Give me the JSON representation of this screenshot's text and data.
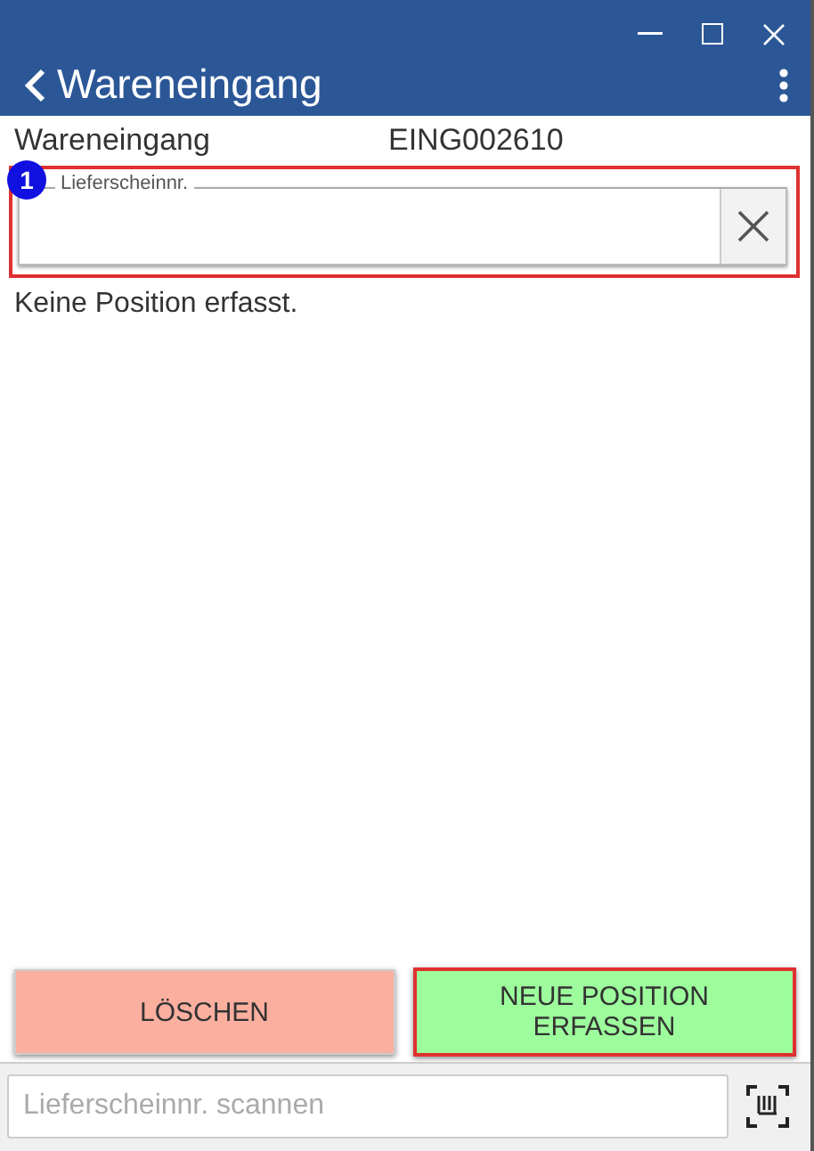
{
  "window": {
    "title": "Wareneingang"
  },
  "info": {
    "label": "Wareneingang",
    "value": "EING002610"
  },
  "field": {
    "badge": "1",
    "label": "Lieferscheinnr.",
    "highlighted": true
  },
  "message": "Keine Position erfasst.",
  "buttons": [
    {
      "label": "LÖSCHEN",
      "kind": "delete",
      "highlighted": false
    },
    {
      "label": "NEUE POSITION ERFASSEN",
      "kind": "add",
      "highlighted": true
    }
  ],
  "scan": {
    "placeholder": "Lieferscheinnr. scannen"
  }
}
